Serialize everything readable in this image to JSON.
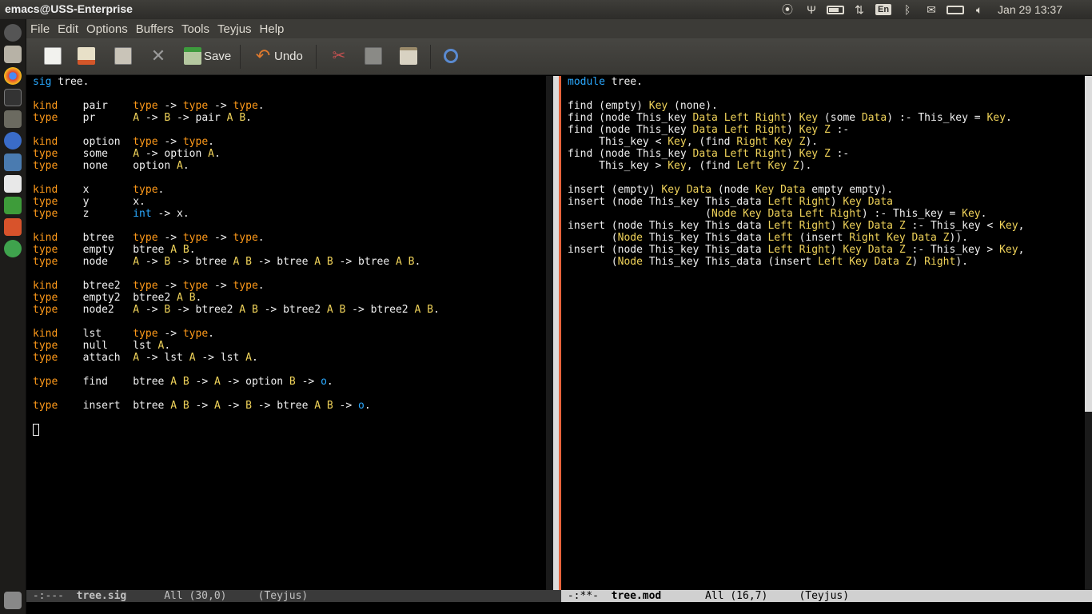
{
  "window": {
    "title": "emacs@USS-Enterprise"
  },
  "tray": {
    "keyboard_layout": "En",
    "clock": "Jan 29 13:37",
    "icons": [
      "antenna-icon",
      "usb-icon",
      "battery-icon",
      "network-arrows-icon",
      "keyboard-icon",
      "bluetooth-icon",
      "mail-icon",
      "battery-plug-icon",
      "volume-icon"
    ]
  },
  "launcher": {
    "icons": [
      "dash-icon",
      "files-icon",
      "chrome-icon",
      "terminal-icon",
      "settings-icon",
      "browser-icon",
      "app-icon",
      "writer-icon",
      "calc-icon",
      "impress-icon",
      "globe-icon",
      "trash-icon"
    ]
  },
  "menu": [
    "File",
    "Edit",
    "Options",
    "Buffers",
    "Tools",
    "Teyjus",
    "Help"
  ],
  "toolbar": {
    "save_label": "Save",
    "undo_label": "Undo"
  },
  "left_buffer": {
    "lines": [
      [
        [
          "kw_blue",
          "sig"
        ],
        [
          "txt",
          " tree."
        ]
      ],
      [],
      [
        [
          "kw",
          "kind"
        ],
        [
          "txt",
          "    pair    "
        ],
        [
          "kw",
          "type"
        ],
        [
          "txt",
          " -> "
        ],
        [
          "kw",
          "type"
        ],
        [
          "txt",
          " -> "
        ],
        [
          "kw",
          "type"
        ],
        [
          "txt",
          "."
        ]
      ],
      [
        [
          "kw",
          "type"
        ],
        [
          "txt",
          "    pr      "
        ],
        [
          "ty",
          "A"
        ],
        [
          "txt",
          " -> "
        ],
        [
          "ty",
          "B"
        ],
        [
          "txt",
          " -> pair "
        ],
        [
          "ty",
          "A"
        ],
        [
          "txt",
          " "
        ],
        [
          "ty",
          "B"
        ],
        [
          "txt",
          "."
        ]
      ],
      [],
      [
        [
          "kw",
          "kind"
        ],
        [
          "txt",
          "    option  "
        ],
        [
          "kw",
          "type"
        ],
        [
          "txt",
          " -> "
        ],
        [
          "kw",
          "type"
        ],
        [
          "txt",
          "."
        ]
      ],
      [
        [
          "kw",
          "type"
        ],
        [
          "txt",
          "    some    "
        ],
        [
          "ty",
          "A"
        ],
        [
          "txt",
          " -> option "
        ],
        [
          "ty",
          "A"
        ],
        [
          "txt",
          "."
        ]
      ],
      [
        [
          "kw",
          "type"
        ],
        [
          "txt",
          "    none    option "
        ],
        [
          "ty",
          "A"
        ],
        [
          "txt",
          "."
        ]
      ],
      [],
      [
        [
          "kw",
          "kind"
        ],
        [
          "txt",
          "    x       "
        ],
        [
          "kw",
          "type"
        ],
        [
          "txt",
          "."
        ]
      ],
      [
        [
          "kw",
          "type"
        ],
        [
          "txt",
          "    y       x."
        ]
      ],
      [
        [
          "kw",
          "type"
        ],
        [
          "txt",
          "    z       "
        ],
        [
          "bi",
          "int"
        ],
        [
          "txt",
          " -> x."
        ]
      ],
      [],
      [
        [
          "kw",
          "kind"
        ],
        [
          "txt",
          "    btree   "
        ],
        [
          "kw",
          "type"
        ],
        [
          "txt",
          " -> "
        ],
        [
          "kw",
          "type"
        ],
        [
          "txt",
          " -> "
        ],
        [
          "kw",
          "type"
        ],
        [
          "txt",
          "."
        ]
      ],
      [
        [
          "kw",
          "type"
        ],
        [
          "txt",
          "    empty   btree "
        ],
        [
          "ty",
          "A"
        ],
        [
          "txt",
          " "
        ],
        [
          "ty",
          "B"
        ],
        [
          "txt",
          "."
        ]
      ],
      [
        [
          "kw",
          "type"
        ],
        [
          "txt",
          "    node    "
        ],
        [
          "ty",
          "A"
        ],
        [
          "txt",
          " -> "
        ],
        [
          "ty",
          "B"
        ],
        [
          "txt",
          " -> btree "
        ],
        [
          "ty",
          "A"
        ],
        [
          "txt",
          " "
        ],
        [
          "ty",
          "B"
        ],
        [
          "txt",
          " -> btree "
        ],
        [
          "ty",
          "A"
        ],
        [
          "txt",
          " "
        ],
        [
          "ty",
          "B"
        ],
        [
          "txt",
          " -> btree "
        ],
        [
          "ty",
          "A"
        ],
        [
          "txt",
          " "
        ],
        [
          "ty",
          "B"
        ],
        [
          "txt",
          "."
        ]
      ],
      [],
      [
        [
          "kw",
          "kind"
        ],
        [
          "txt",
          "    btree2  "
        ],
        [
          "kw",
          "type"
        ],
        [
          "txt",
          " -> "
        ],
        [
          "kw",
          "type"
        ],
        [
          "txt",
          " -> "
        ],
        [
          "kw",
          "type"
        ],
        [
          "txt",
          "."
        ]
      ],
      [
        [
          "kw",
          "type"
        ],
        [
          "txt",
          "    empty2  btree2 "
        ],
        [
          "ty",
          "A"
        ],
        [
          "txt",
          " "
        ],
        [
          "ty",
          "B"
        ],
        [
          "txt",
          "."
        ]
      ],
      [
        [
          "kw",
          "type"
        ],
        [
          "txt",
          "    node2   "
        ],
        [
          "ty",
          "A"
        ],
        [
          "txt",
          " -> "
        ],
        [
          "ty",
          "B"
        ],
        [
          "txt",
          " -> btree2 "
        ],
        [
          "ty",
          "A"
        ],
        [
          "txt",
          " "
        ],
        [
          "ty",
          "B"
        ],
        [
          "txt",
          " -> btree2 "
        ],
        [
          "ty",
          "A"
        ],
        [
          "txt",
          " "
        ],
        [
          "ty",
          "B"
        ],
        [
          "txt",
          " -> btree2 "
        ],
        [
          "ty",
          "A"
        ],
        [
          "txt",
          " "
        ],
        [
          "ty",
          "B"
        ],
        [
          "txt",
          "."
        ]
      ],
      [],
      [
        [
          "kw",
          "kind"
        ],
        [
          "txt",
          "    lst     "
        ],
        [
          "kw",
          "type"
        ],
        [
          "txt",
          " -> "
        ],
        [
          "kw",
          "type"
        ],
        [
          "txt",
          "."
        ]
      ],
      [
        [
          "kw",
          "type"
        ],
        [
          "txt",
          "    null    lst "
        ],
        [
          "ty",
          "A"
        ],
        [
          "txt",
          "."
        ]
      ],
      [
        [
          "kw",
          "type"
        ],
        [
          "txt",
          "    attach  "
        ],
        [
          "ty",
          "A"
        ],
        [
          "txt",
          " -> lst "
        ],
        [
          "ty",
          "A"
        ],
        [
          "txt",
          " -> lst "
        ],
        [
          "ty",
          "A"
        ],
        [
          "txt",
          "."
        ]
      ],
      [],
      [
        [
          "kw",
          "type"
        ],
        [
          "txt",
          "    find    btree "
        ],
        [
          "ty",
          "A"
        ],
        [
          "txt",
          " "
        ],
        [
          "ty",
          "B"
        ],
        [
          "txt",
          " -> "
        ],
        [
          "ty",
          "A"
        ],
        [
          "txt",
          " -> option "
        ],
        [
          "ty",
          "B"
        ],
        [
          "txt",
          " -> "
        ],
        [
          "bi",
          "o"
        ],
        [
          "txt",
          "."
        ]
      ],
      [],
      [
        [
          "kw",
          "type"
        ],
        [
          "txt",
          "    insert  btree "
        ],
        [
          "ty",
          "A"
        ],
        [
          "txt",
          " "
        ],
        [
          "ty",
          "B"
        ],
        [
          "txt",
          " -> "
        ],
        [
          "ty",
          "A"
        ],
        [
          "txt",
          " -> "
        ],
        [
          "ty",
          "B"
        ],
        [
          "txt",
          " -> btree "
        ],
        [
          "ty",
          "A"
        ],
        [
          "txt",
          " "
        ],
        [
          "ty",
          "B"
        ],
        [
          "txt",
          " -> "
        ],
        [
          "bi",
          "o"
        ],
        [
          "txt",
          "."
        ]
      ]
    ]
  },
  "right_buffer": {
    "lines": [
      [
        [
          "kw_blue",
          "module"
        ],
        [
          "txt",
          " tree."
        ]
      ],
      [],
      [
        [
          "txt",
          "find (empty) "
        ],
        [
          "ty",
          "Key"
        ],
        [
          "txt",
          " (none)."
        ]
      ],
      [
        [
          "txt",
          "find (node This_key "
        ],
        [
          "ty",
          "Data"
        ],
        [
          "txt",
          " "
        ],
        [
          "ty",
          "Left"
        ],
        [
          "txt",
          " "
        ],
        [
          "ty",
          "Right"
        ],
        [
          "txt",
          ") "
        ],
        [
          "ty",
          "Key"
        ],
        [
          "txt",
          " (some "
        ],
        [
          "ty",
          "Data"
        ],
        [
          "txt",
          ") :- This_key = "
        ],
        [
          "ty",
          "Key"
        ],
        [
          "txt",
          "."
        ]
      ],
      [
        [
          "txt",
          "find (node This_key "
        ],
        [
          "ty",
          "Data"
        ],
        [
          "txt",
          " "
        ],
        [
          "ty",
          "Left"
        ],
        [
          "txt",
          " "
        ],
        [
          "ty",
          "Right"
        ],
        [
          "txt",
          ") "
        ],
        [
          "ty",
          "Key"
        ],
        [
          "txt",
          " "
        ],
        [
          "ty",
          "Z"
        ],
        [
          "txt",
          " :-"
        ]
      ],
      [
        [
          "txt",
          "     This_key < "
        ],
        [
          "ty",
          "Key"
        ],
        [
          "txt",
          ", (find "
        ],
        [
          "ty",
          "Right"
        ],
        [
          "txt",
          " "
        ],
        [
          "ty",
          "Key"
        ],
        [
          "txt",
          " "
        ],
        [
          "ty",
          "Z"
        ],
        [
          "txt",
          ")."
        ]
      ],
      [
        [
          "txt",
          "find (node This_key "
        ],
        [
          "ty",
          "Data"
        ],
        [
          "txt",
          " "
        ],
        [
          "ty",
          "Left"
        ],
        [
          "txt",
          " "
        ],
        [
          "ty",
          "Right"
        ],
        [
          "txt",
          ") "
        ],
        [
          "ty",
          "Key"
        ],
        [
          "txt",
          " "
        ],
        [
          "ty",
          "Z"
        ],
        [
          "txt",
          " :-"
        ]
      ],
      [
        [
          "txt",
          "     This_key > "
        ],
        [
          "ty",
          "Key"
        ],
        [
          "txt",
          ", (find "
        ],
        [
          "ty",
          "Left"
        ],
        [
          "txt",
          " "
        ],
        [
          "ty",
          "Key"
        ],
        [
          "txt",
          " "
        ],
        [
          "ty",
          "Z"
        ],
        [
          "txt",
          ")."
        ]
      ],
      [],
      [
        [
          "txt",
          "insert (empty) "
        ],
        [
          "ty",
          "Key"
        ],
        [
          "txt",
          " "
        ],
        [
          "ty",
          "Data"
        ],
        [
          "txt",
          " (node "
        ],
        [
          "ty",
          "Key"
        ],
        [
          "txt",
          " "
        ],
        [
          "ty",
          "Data"
        ],
        [
          "txt",
          " empty empty)."
        ]
      ],
      [
        [
          "txt",
          "insert (node This_key This_data "
        ],
        [
          "ty",
          "Left"
        ],
        [
          "txt",
          " "
        ],
        [
          "ty",
          "Right"
        ],
        [
          "txt",
          ") "
        ],
        [
          "ty",
          "Key"
        ],
        [
          "txt",
          " "
        ],
        [
          "ty",
          "Data"
        ]
      ],
      [
        [
          "txt",
          "                      ("
        ],
        [
          "ty",
          "Node"
        ],
        [
          "txt",
          " "
        ],
        [
          "ty",
          "Key"
        ],
        [
          "txt",
          " "
        ],
        [
          "ty",
          "Data"
        ],
        [
          "txt",
          " "
        ],
        [
          "ty",
          "Left"
        ],
        [
          "txt",
          " "
        ],
        [
          "ty",
          "Right"
        ],
        [
          "txt",
          ") :- This_key = "
        ],
        [
          "ty",
          "Key"
        ],
        [
          "txt",
          "."
        ]
      ],
      [
        [
          "txt",
          "insert (node This_key This_data "
        ],
        [
          "ty",
          "Left"
        ],
        [
          "txt",
          " "
        ],
        [
          "ty",
          "Right"
        ],
        [
          "txt",
          ") "
        ],
        [
          "ty",
          "Key"
        ],
        [
          "txt",
          " "
        ],
        [
          "ty",
          "Data"
        ],
        [
          "txt",
          " "
        ],
        [
          "ty",
          "Z"
        ],
        [
          "txt",
          " :- This_key < "
        ],
        [
          "ty",
          "Key"
        ],
        [
          "txt",
          ","
        ]
      ],
      [
        [
          "txt",
          "       ("
        ],
        [
          "ty",
          "Node"
        ],
        [
          "txt",
          " This_key This_data "
        ],
        [
          "ty",
          "Left"
        ],
        [
          "txt",
          " (insert "
        ],
        [
          "ty",
          "Right"
        ],
        [
          "txt",
          " "
        ],
        [
          "ty",
          "Key"
        ],
        [
          "txt",
          " "
        ],
        [
          "ty",
          "Data"
        ],
        [
          "txt",
          " "
        ],
        [
          "ty",
          "Z"
        ],
        [
          "txt",
          "))."
        ]
      ],
      [
        [
          "txt",
          "insert (node This_key This_data "
        ],
        [
          "ty",
          "Left"
        ],
        [
          "txt",
          " "
        ],
        [
          "ty",
          "Right"
        ],
        [
          "txt",
          ") "
        ],
        [
          "ty",
          "Key"
        ],
        [
          "txt",
          " "
        ],
        [
          "ty",
          "Data"
        ],
        [
          "txt",
          " "
        ],
        [
          "ty",
          "Z"
        ],
        [
          "txt",
          " :- This_key > "
        ],
        [
          "ty",
          "Key"
        ],
        [
          "txt",
          ","
        ]
      ],
      [
        [
          "txt",
          "       ("
        ],
        [
          "ty",
          "Node"
        ],
        [
          "txt",
          " This_key This_data (insert "
        ],
        [
          "ty",
          "Left"
        ],
        [
          "txt",
          " "
        ],
        [
          "ty",
          "Key"
        ],
        [
          "txt",
          " "
        ],
        [
          "ty",
          "Data"
        ],
        [
          "txt",
          " "
        ],
        [
          "ty",
          "Z"
        ],
        [
          "txt",
          ") "
        ],
        [
          "ty",
          "Right"
        ],
        [
          "txt",
          ")."
        ]
      ]
    ]
  },
  "modeline_left": {
    "status": " -:---  ",
    "buffer": "tree.sig",
    "position": "      All (30,0)     ",
    "mode": "(Teyjus)"
  },
  "modeline_right": {
    "status": " -:**-  ",
    "buffer": "tree.mod",
    "position": "       All (16,7)     ",
    "mode": "(Teyjus)"
  },
  "colors": {
    "keyword": "#ff9a1a",
    "type_var": "#f0d35a",
    "builtin": "#2aa9ff",
    "text": "#f0f0f0"
  }
}
